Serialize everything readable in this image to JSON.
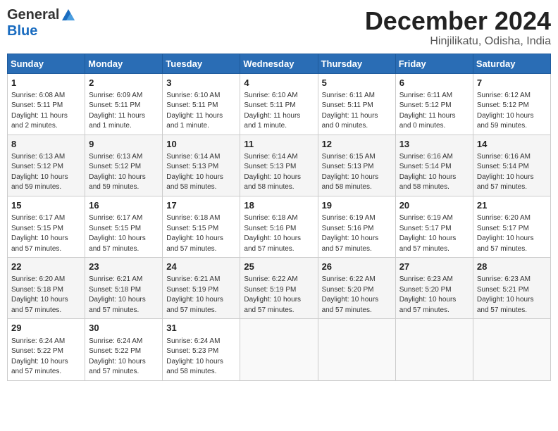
{
  "header": {
    "logo_general": "General",
    "logo_blue": "Blue",
    "month_title": "December 2024",
    "location": "Hinjilikatu, Odisha, India"
  },
  "calendar": {
    "days_of_week": [
      "Sunday",
      "Monday",
      "Tuesday",
      "Wednesday",
      "Thursday",
      "Friday",
      "Saturday"
    ],
    "weeks": [
      [
        null,
        null,
        null,
        null,
        {
          "day": 5,
          "sunrise": "Sunrise: 6:11 AM",
          "sunset": "Sunset: 5:11 PM",
          "daylight": "Daylight: 11 hours and 0 minutes."
        },
        {
          "day": 6,
          "sunrise": "Sunrise: 6:11 AM",
          "sunset": "Sunset: 5:12 PM",
          "daylight": "Daylight: 11 hours and 0 minutes."
        },
        {
          "day": 7,
          "sunrise": "Sunrise: 6:12 AM",
          "sunset": "Sunset: 5:12 PM",
          "daylight": "Daylight: 10 hours and 59 minutes."
        }
      ],
      [
        {
          "day": 8,
          "sunrise": "Sunrise: 6:13 AM",
          "sunset": "Sunset: 5:12 PM",
          "daylight": "Daylight: 10 hours and 59 minutes."
        },
        {
          "day": 9,
          "sunrise": "Sunrise: 6:13 AM",
          "sunset": "Sunset: 5:12 PM",
          "daylight": "Daylight: 10 hours and 59 minutes."
        },
        {
          "day": 10,
          "sunrise": "Sunrise: 6:14 AM",
          "sunset": "Sunset: 5:13 PM",
          "daylight": "Daylight: 10 hours and 58 minutes."
        },
        {
          "day": 11,
          "sunrise": "Sunrise: 6:14 AM",
          "sunset": "Sunset: 5:13 PM",
          "daylight": "Daylight: 10 hours and 58 minutes."
        },
        {
          "day": 12,
          "sunrise": "Sunrise: 6:15 AM",
          "sunset": "Sunset: 5:13 PM",
          "daylight": "Daylight: 10 hours and 58 minutes."
        },
        {
          "day": 13,
          "sunrise": "Sunrise: 6:16 AM",
          "sunset": "Sunset: 5:14 PM",
          "daylight": "Daylight: 10 hours and 58 minutes."
        },
        {
          "day": 14,
          "sunrise": "Sunrise: 6:16 AM",
          "sunset": "Sunset: 5:14 PM",
          "daylight": "Daylight: 10 hours and 57 minutes."
        }
      ],
      [
        {
          "day": 15,
          "sunrise": "Sunrise: 6:17 AM",
          "sunset": "Sunset: 5:15 PM",
          "daylight": "Daylight: 10 hours and 57 minutes."
        },
        {
          "day": 16,
          "sunrise": "Sunrise: 6:17 AM",
          "sunset": "Sunset: 5:15 PM",
          "daylight": "Daylight: 10 hours and 57 minutes."
        },
        {
          "day": 17,
          "sunrise": "Sunrise: 6:18 AM",
          "sunset": "Sunset: 5:15 PM",
          "daylight": "Daylight: 10 hours and 57 minutes."
        },
        {
          "day": 18,
          "sunrise": "Sunrise: 6:18 AM",
          "sunset": "Sunset: 5:16 PM",
          "daylight": "Daylight: 10 hours and 57 minutes."
        },
        {
          "day": 19,
          "sunrise": "Sunrise: 6:19 AM",
          "sunset": "Sunset: 5:16 PM",
          "daylight": "Daylight: 10 hours and 57 minutes."
        },
        {
          "day": 20,
          "sunrise": "Sunrise: 6:19 AM",
          "sunset": "Sunset: 5:17 PM",
          "daylight": "Daylight: 10 hours and 57 minutes."
        },
        {
          "day": 21,
          "sunrise": "Sunrise: 6:20 AM",
          "sunset": "Sunset: 5:17 PM",
          "daylight": "Daylight: 10 hours and 57 minutes."
        }
      ],
      [
        {
          "day": 22,
          "sunrise": "Sunrise: 6:20 AM",
          "sunset": "Sunset: 5:18 PM",
          "daylight": "Daylight: 10 hours and 57 minutes."
        },
        {
          "day": 23,
          "sunrise": "Sunrise: 6:21 AM",
          "sunset": "Sunset: 5:18 PM",
          "daylight": "Daylight: 10 hours and 57 minutes."
        },
        {
          "day": 24,
          "sunrise": "Sunrise: 6:21 AM",
          "sunset": "Sunset: 5:19 PM",
          "daylight": "Daylight: 10 hours and 57 minutes."
        },
        {
          "day": 25,
          "sunrise": "Sunrise: 6:22 AM",
          "sunset": "Sunset: 5:19 PM",
          "daylight": "Daylight: 10 hours and 57 minutes."
        },
        {
          "day": 26,
          "sunrise": "Sunrise: 6:22 AM",
          "sunset": "Sunset: 5:20 PM",
          "daylight": "Daylight: 10 hours and 57 minutes."
        },
        {
          "day": 27,
          "sunrise": "Sunrise: 6:23 AM",
          "sunset": "Sunset: 5:20 PM",
          "daylight": "Daylight: 10 hours and 57 minutes."
        },
        {
          "day": 28,
          "sunrise": "Sunrise: 6:23 AM",
          "sunset": "Sunset: 5:21 PM",
          "daylight": "Daylight: 10 hours and 57 minutes."
        }
      ],
      [
        {
          "day": 29,
          "sunrise": "Sunrise: 6:24 AM",
          "sunset": "Sunset: 5:22 PM",
          "daylight": "Daylight: 10 hours and 57 minutes."
        },
        {
          "day": 30,
          "sunrise": "Sunrise: 6:24 AM",
          "sunset": "Sunset: 5:22 PM",
          "daylight": "Daylight: 10 hours and 57 minutes."
        },
        {
          "day": 31,
          "sunrise": "Sunrise: 6:24 AM",
          "sunset": "Sunset: 5:23 PM",
          "daylight": "Daylight: 10 hours and 58 minutes."
        },
        null,
        null,
        null,
        null
      ]
    ],
    "week1_special": [
      {
        "day": 1,
        "sunrise": "Sunrise: 6:08 AM",
        "sunset": "Sunset: 5:11 PM",
        "daylight": "Daylight: 11 hours and 2 minutes."
      },
      {
        "day": 2,
        "sunrise": "Sunrise: 6:09 AM",
        "sunset": "Sunset: 5:11 PM",
        "daylight": "Daylight: 11 hours and 1 minute."
      },
      {
        "day": 3,
        "sunrise": "Sunrise: 6:10 AM",
        "sunset": "Sunset: 5:11 PM",
        "daylight": "Daylight: 11 hours and 1 minute."
      },
      {
        "day": 4,
        "sunrise": "Sunrise: 6:10 AM",
        "sunset": "Sunset: 5:11 PM",
        "daylight": "Daylight: 11 hours and 1 minute."
      }
    ]
  }
}
